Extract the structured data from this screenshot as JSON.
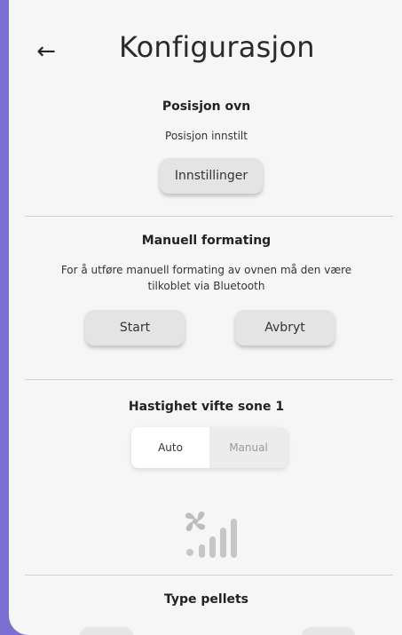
{
  "header": {
    "title": "Konfigurasjon",
    "back_icon": "←"
  },
  "position": {
    "title": "Posisjon ovn",
    "status": "Posisjon innstilt",
    "settings_button": "Innstillinger"
  },
  "manual_format": {
    "title": "Manuell formating",
    "description_line1": "For å utføre manuell formating av ovnen må den være",
    "description_line2": "tilkoblet via Bluetooth",
    "start_button": "Start",
    "cancel_button": "Avbryt"
  },
  "fan": {
    "title": "Hastighet vifte sone 1",
    "options": [
      "Auto",
      "Manual"
    ],
    "selected": "Auto",
    "icon": "fan-speed-icon"
  },
  "pellets": {
    "title": "Type pellets"
  },
  "colors": {
    "background": "#f6f6f6",
    "button": "#e4e4e4",
    "divider": "#cfcfcf",
    "accent": "#7b6fd1"
  }
}
